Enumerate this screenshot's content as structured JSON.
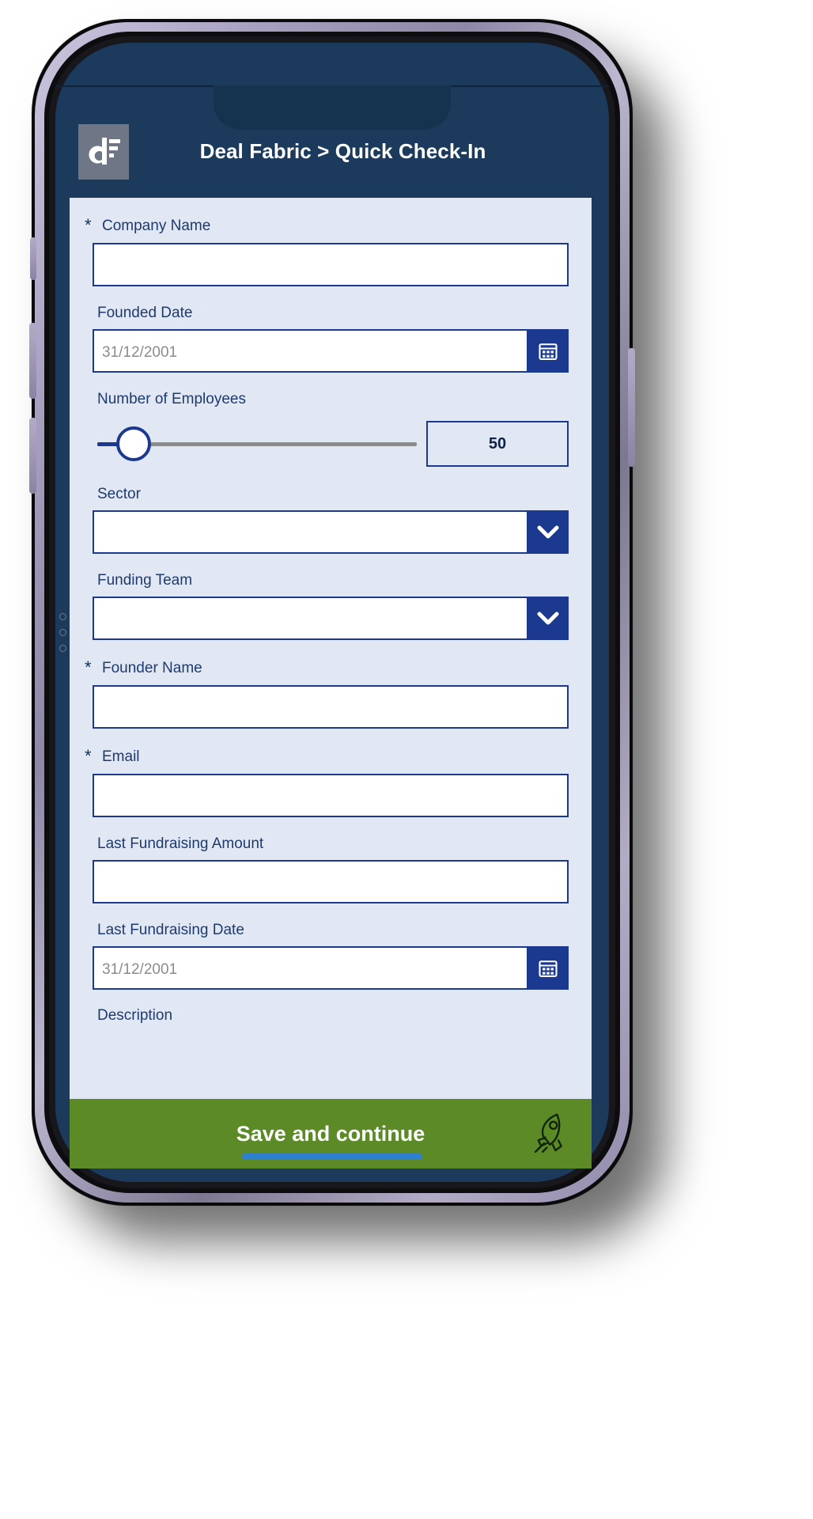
{
  "app": {
    "title": "Deal Fabric > Quick Check-In",
    "logo_icon": "df-logo-icon",
    "header_bg": "#1b3a5c",
    "form_bg": "#e1e8f3",
    "accent": "#1b3a8f",
    "footer_bg": "#5b8a27"
  },
  "form": {
    "fields": [
      {
        "label": "Company Name",
        "required": "*",
        "type": "text",
        "value": "",
        "placeholder": ""
      },
      {
        "label": "Founded Date",
        "required": "",
        "type": "date",
        "value": "",
        "placeholder": "31/12/2001",
        "icon": "calendar-icon"
      },
      {
        "label": "Number of Employees",
        "required": "",
        "type": "slider",
        "value": "50",
        "min": "0",
        "max": "500"
      },
      {
        "label": "Sector",
        "required": "",
        "type": "select",
        "value": "",
        "placeholder": "",
        "icon": "chevron-down-icon"
      },
      {
        "label": "Funding Team",
        "required": "",
        "type": "select",
        "value": "",
        "placeholder": "",
        "icon": "chevron-down-icon"
      },
      {
        "label": "Founder Name",
        "required": "*",
        "type": "text",
        "value": "",
        "placeholder": ""
      },
      {
        "label": "Email",
        "required": "*",
        "type": "text",
        "value": "",
        "placeholder": ""
      },
      {
        "label": "Last Fundraising Amount",
        "required": "",
        "type": "text",
        "value": "",
        "placeholder": ""
      },
      {
        "label": "Last Fundraising Date",
        "required": "",
        "type": "date",
        "value": "",
        "placeholder": "31/12/2001",
        "icon": "calendar-icon"
      }
    ],
    "clipped_label": "Description"
  },
  "footer": {
    "save_label": "Save and continue",
    "icon": "rocket-icon"
  }
}
